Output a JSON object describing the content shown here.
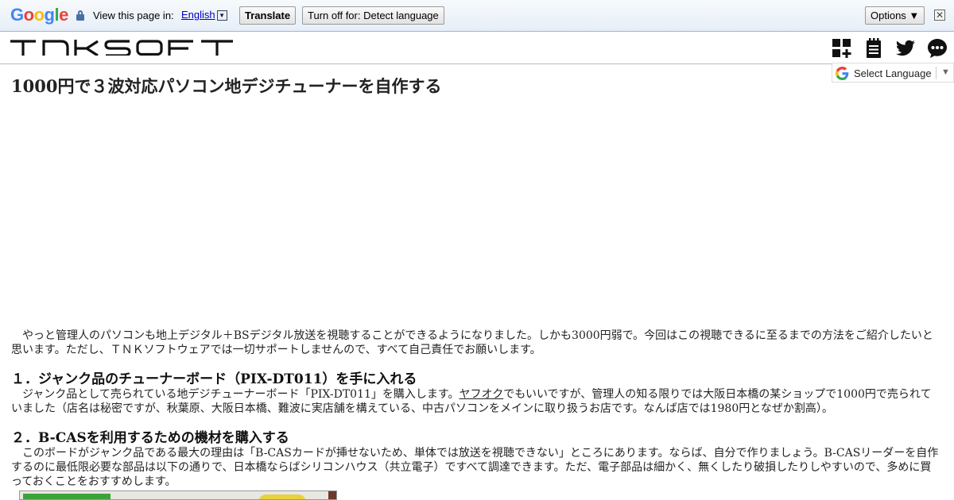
{
  "translate_bar": {
    "logo": "Google",
    "view_text": "View this page in:",
    "language": "English",
    "language_arrow": "▼",
    "translate_label": "Translate",
    "turnoff_label": "Turn off for: Detect language",
    "options_label": "Options ▼",
    "close_symbol": "✕"
  },
  "header": {
    "logo_text": "TNKSOFT",
    "icons": [
      "apps-add-icon",
      "notepad-icon",
      "twitter-icon",
      "chat-icon"
    ]
  },
  "select_language": {
    "label": "Select Language",
    "arrow": "▼"
  },
  "article": {
    "title": "1000円で３波対応パソコン地デジチューナーを自作する",
    "intro": "やっと管理人のパソコンも地上デジタル＋BSデジタル放送を視聴することができるようになりました。しかも3000円弱で。今回はこの視聴できるに至るまでの方法をご紹介したいと思います。ただし、ＴＮＫソフトウェアでは一切サポートしませんので、すべて自己責任でお願いします。",
    "section1": {
      "heading": "１．ジャンク品のチューナーボード（PIX-DT011）を手に入れる",
      "text_before_link": "ジャンク品として売られている地デジチューナーボード「PIX-DT011」を購入します。",
      "link": "ヤフオク",
      "text_after_link": "でもいいですが、管理人の知る限りでは大阪日本橋の某ショップで1000円で売られていました（店名は秘密ですが、秋葉原、大阪日本橋、難波に実店舗を構えている、中古パソコンをメインに取り扱うお店です。なんば店では1980円となぜか割高）。"
    },
    "section2": {
      "heading": "２．B-CASを利用するための機材を購入する",
      "text": "このボードがジャンク品である最大の理由は「B-CASカードが挿せないため、単体では放送を視聴できない」ところにあります。ならば、自分で作りましょう。B-CASリーダーを自作するのに最低限必要な部品は以下の通りで、日本橋ならばシリコンハウス（共立電子）ですべて調達できます。ただ、電子部品は細かく、無くしたり破損したりしやすいので、多めに買っておくことをおすすめします。"
    }
  },
  "colors": {
    "google_blue": "#4285F4",
    "google_red": "#EA4335",
    "google_yellow": "#FBBC05",
    "google_green": "#34A853",
    "text": "#222222"
  }
}
